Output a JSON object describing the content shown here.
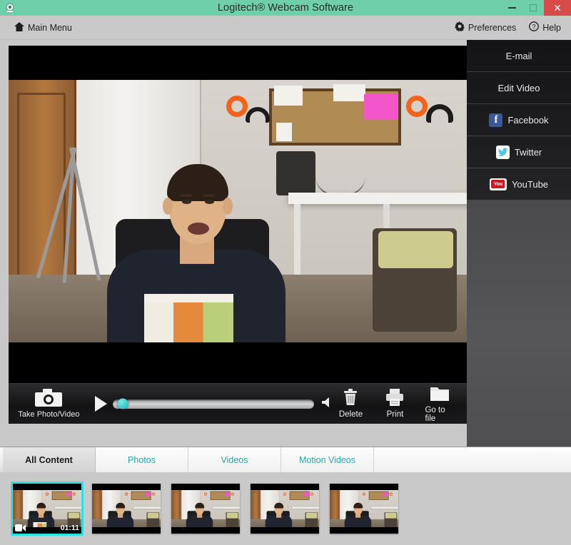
{
  "window": {
    "title": "Logitech® Webcam Software",
    "app_icon": "webcam-icon",
    "minimize_label": "–",
    "maximize_label": "□",
    "close_label": "✕",
    "accent_color": "#6ECFAA",
    "close_color": "#d94b4b"
  },
  "toolbar": {
    "main_menu": "Main Menu",
    "main_menu_icon": "home-icon",
    "preferences": "Preferences",
    "preferences_icon": "gear-icon",
    "help": "Help",
    "help_icon": "question-circle-icon"
  },
  "side_panel": {
    "items": [
      {
        "label": "E-mail",
        "icon": ""
      },
      {
        "label": "Edit Video",
        "icon": ""
      },
      {
        "label": "Facebook",
        "icon": "facebook-icon"
      },
      {
        "label": "Twitter",
        "icon": "twitter-icon"
      },
      {
        "label": "YouTube",
        "icon": "youtube-icon"
      }
    ]
  },
  "controls": {
    "capture_label": "Take Photo/Video",
    "capture_icon": "camera-icon",
    "play_icon": "play-icon",
    "scrubber_position_percent": 5,
    "scrubber_thumb_color": "#13b8bd",
    "volume_icon": "speaker-icon",
    "buttons": [
      {
        "label": "Delete",
        "icon": "trash-icon"
      },
      {
        "label": "Print",
        "icon": "printer-icon"
      },
      {
        "label": "Go to file",
        "icon": "folder-icon"
      }
    ]
  },
  "tabs": [
    {
      "label": "All Content",
      "active": true
    },
    {
      "label": "Photos",
      "active": false
    },
    {
      "label": "Videos",
      "active": false
    },
    {
      "label": "Motion Videos",
      "active": false
    }
  ],
  "gallery": {
    "items": [
      {
        "duration": "01:11",
        "type": "video",
        "selected": true
      },
      {
        "duration": "",
        "type": "photo",
        "selected": false
      },
      {
        "duration": "",
        "type": "photo",
        "selected": false
      },
      {
        "duration": "",
        "type": "photo",
        "selected": false
      },
      {
        "duration": "",
        "type": "photo",
        "selected": false
      }
    ],
    "selected_border_color": "#2ce0e0"
  }
}
